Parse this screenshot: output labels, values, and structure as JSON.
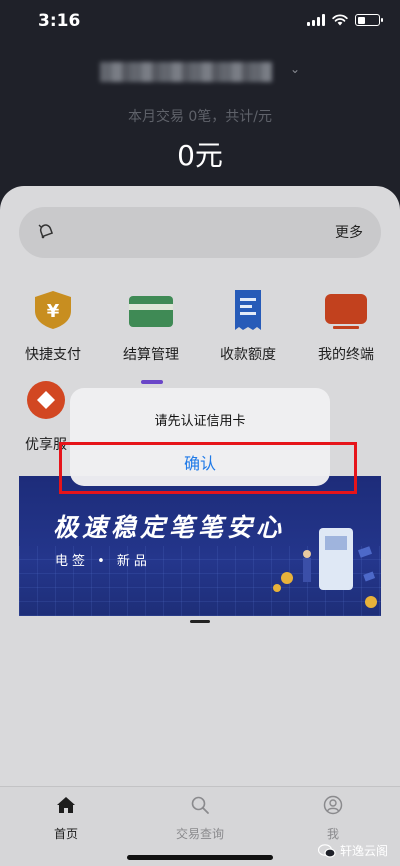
{
  "status_bar": {
    "time": "3:16"
  },
  "header": {
    "merchant_chevron": "⌄",
    "month_summary": "本月交易 0笔，共计/元",
    "month_total": "0元"
  },
  "notice_bar": {
    "more_label": "更多",
    "icon": "bell-icon"
  },
  "grid": {
    "items": [
      {
        "label": "快捷支付",
        "icon": "yuan-shield-icon"
      },
      {
        "label": "结算管理",
        "icon": "bank-card-icon"
      },
      {
        "label": "收款额度",
        "icon": "receipt-icon"
      },
      {
        "label": "我的终端",
        "icon": "terminal-icon"
      },
      {
        "label": "优享服",
        "icon": "diamond-icon"
      }
    ]
  },
  "banner": {
    "title": "极速稳定笔笔安心",
    "subtitle": "电签 • 新品"
  },
  "dialog": {
    "message": "请先认证信用卡",
    "confirm_label": "确认"
  },
  "tab_bar": {
    "tabs": [
      {
        "label": "首页",
        "icon": "home-icon",
        "active": true
      },
      {
        "label": "交易查询",
        "icon": "search-icon",
        "active": false
      },
      {
        "label": "我",
        "icon": "user-icon",
        "active": false
      }
    ]
  },
  "watermark": {
    "text": "轩逸云阁"
  },
  "colors": {
    "accent_blue": "#1f7ae8",
    "highlight_red": "#e6141a",
    "header_bg": "#1f2129"
  }
}
